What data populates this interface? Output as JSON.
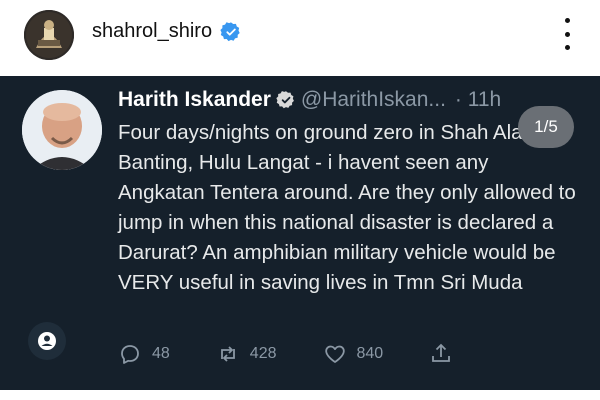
{
  "instagram": {
    "username": "shahrol_shiro"
  },
  "tweet": {
    "display_name": "Harith Iskander",
    "handle": "@HarithIskan...",
    "time": "· 11h",
    "text": "Four days/nights on ground zero in Shah Alam, Banting, Hulu Langat - i havent seen any Angkatan Tentera around. Are they only allowed to jump in when this national disaster is declared a Darurat? An amphibian military vehicle would be VERY useful in saving lives in Tmn Sri Muda",
    "actions": {
      "replies": "48",
      "retweets": "428",
      "likes": "840"
    }
  },
  "carousel": {
    "position": "1/5"
  },
  "colors": {
    "tweet_bg": "#15202b",
    "verified_blue": "#1d9bf0",
    "text": "#e7e9ea",
    "muted": "#8b98a5"
  },
  "icons": [
    "profile-avatar",
    "verified-badge-icon",
    "more-options-icon",
    "reply-icon",
    "retweet-icon",
    "like-icon",
    "share-icon",
    "user-tag-icon"
  ]
}
